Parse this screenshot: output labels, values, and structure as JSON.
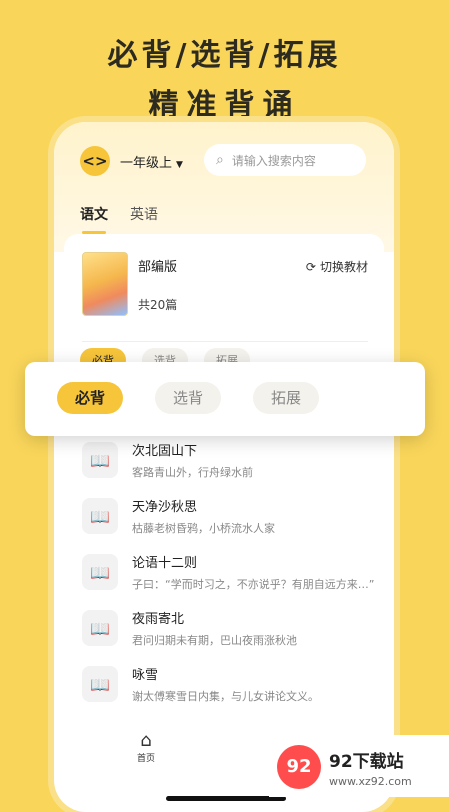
{
  "headline": {
    "line1": "必背/选背/拓展",
    "line2": "精准背诵"
  },
  "header": {
    "back_icon": "<>",
    "grade": "一年级上",
    "grade_caret": "▼",
    "search_placeholder": "请输入搜索内容"
  },
  "lang_tabs": [
    {
      "label": "语文"
    },
    {
      "label": "英语"
    }
  ],
  "book": {
    "edition": "部编版",
    "count": "共20篇",
    "switch_label": "切换教材"
  },
  "mini_tabs": [
    {
      "label": "必背"
    },
    {
      "label": "选背"
    },
    {
      "label": "拓展"
    }
  ],
  "overlay_tabs": [
    {
      "label": "必背"
    },
    {
      "label": "选背"
    },
    {
      "label": "拓展"
    }
  ],
  "lessons": [
    {
      "title": "次北固山下",
      "subtitle": "客路青山外，行舟绿水前"
    },
    {
      "title": "天净沙秋思",
      "subtitle": "枯藤老树昏鸦，小桥流水人家"
    },
    {
      "title": "论语十二则",
      "subtitle": "子曰：“学而时习之，不亦说乎？有朋自远方来…”"
    },
    {
      "title": "夜雨寄北",
      "subtitle": "君问归期未有期，巴山夜雨涨秋池"
    },
    {
      "title": "咏雪",
      "subtitle": "谢太傅寒雪日内集，与儿女讲论文义。"
    }
  ],
  "bottom_nav": {
    "home_label": "首页"
  },
  "watermark": {
    "name": "92下载站",
    "site": "www.xz92.com",
    "logo_text": "92"
  },
  "colors": {
    "background": "#f9d65a",
    "accent": "#f6c53a"
  }
}
